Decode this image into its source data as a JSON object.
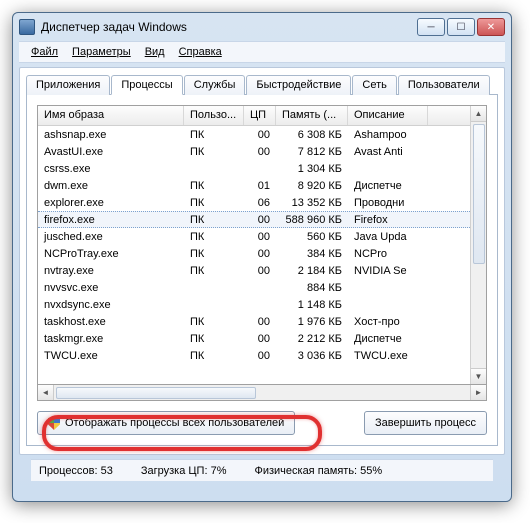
{
  "window": {
    "title": "Диспетчер задач Windows"
  },
  "menu": {
    "file": "Файл",
    "options": "Параметры",
    "view": "Вид",
    "help": "Справка"
  },
  "tabs": {
    "apps": "Приложения",
    "processes": "Процессы",
    "services": "Службы",
    "performance": "Быстродействие",
    "network": "Сеть",
    "users": "Пользователи"
  },
  "columns": {
    "image": "Имя образа",
    "user": "Пользо...",
    "cpu": "ЦП",
    "mem": "Память (...",
    "desc": "Описание"
  },
  "rows": [
    {
      "name": "ashsnap.exe",
      "user": "ПК",
      "cpu": "00",
      "mem": "6 308 КБ",
      "desc": "Ashampoo"
    },
    {
      "name": "AvastUI.exe",
      "user": "ПК",
      "cpu": "00",
      "mem": "7 812 КБ",
      "desc": "Avast Anti"
    },
    {
      "name": "csrss.exe",
      "user": "",
      "cpu": "",
      "mem": "1 304 КБ",
      "desc": ""
    },
    {
      "name": "dwm.exe",
      "user": "ПК",
      "cpu": "01",
      "mem": "8 920 КБ",
      "desc": "Диспетче"
    },
    {
      "name": "explorer.exe",
      "user": "ПК",
      "cpu": "06",
      "mem": "13 352 КБ",
      "desc": "Проводни"
    },
    {
      "name": "firefox.exe",
      "user": "ПК",
      "cpu": "00",
      "mem": "588 960 КБ",
      "desc": "Firefox",
      "selected": true
    },
    {
      "name": "jusched.exe",
      "user": "ПК",
      "cpu": "00",
      "mem": "560 КБ",
      "desc": "Java Upda"
    },
    {
      "name": "NCProTray.exe",
      "user": "ПК",
      "cpu": "00",
      "mem": "384 КБ",
      "desc": "NCPro"
    },
    {
      "name": "nvtray.exe",
      "user": "ПК",
      "cpu": "00",
      "mem": "2 184 КБ",
      "desc": "NVIDIA Se"
    },
    {
      "name": "nvvsvc.exe",
      "user": "",
      "cpu": "",
      "mem": "884 КБ",
      "desc": ""
    },
    {
      "name": "nvxdsync.exe",
      "user": "",
      "cpu": "",
      "mem": "1 148 КБ",
      "desc": ""
    },
    {
      "name": "taskhost.exe",
      "user": "ПК",
      "cpu": "00",
      "mem": "1 976 КБ",
      "desc": "Хост-про"
    },
    {
      "name": "taskmgr.exe",
      "user": "ПК",
      "cpu": "00",
      "mem": "2 212 КБ",
      "desc": "Диспетче"
    },
    {
      "name": "TWCU.exe",
      "user": "ПК",
      "cpu": "00",
      "mem": "3 036 КБ",
      "desc": "TWCU.exe"
    }
  ],
  "buttons": {
    "showAll": "Отображать процессы всех пользователей",
    "end": "Завершить процесс"
  },
  "status": {
    "processes": "Процессов: 53",
    "cpu": "Загрузка ЦП: 7%",
    "mem": "Физическая память: 55%"
  }
}
